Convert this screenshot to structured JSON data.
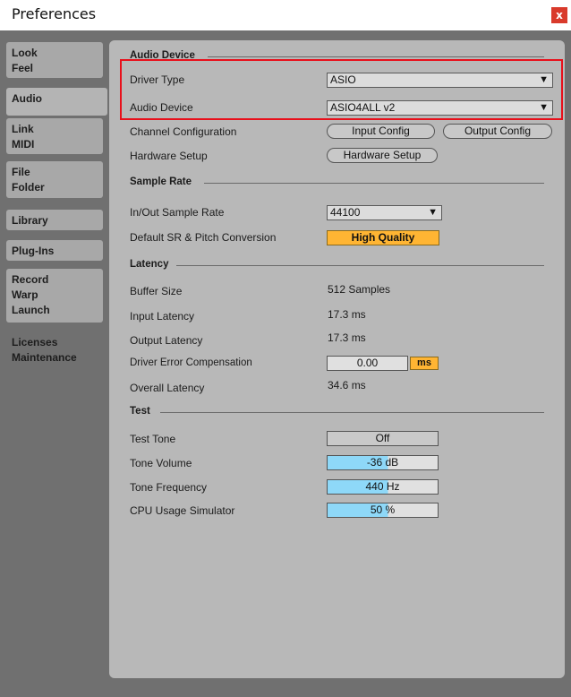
{
  "window": {
    "title": "Preferences",
    "close": "x"
  },
  "sidebar": {
    "tabs": [
      {
        "lines": [
          "Look",
          "Feel"
        ]
      },
      {
        "lines": [
          "Audio"
        ]
      },
      {
        "lines": [
          "Link",
          "MIDI"
        ]
      },
      {
        "lines": [
          "File",
          "Folder"
        ]
      },
      {
        "lines": [
          "Library"
        ]
      },
      {
        "lines": [
          "Plug-Ins"
        ]
      },
      {
        "lines": [
          "Record",
          "Warp",
          "Launch"
        ]
      },
      {
        "lines": [
          "Licenses",
          "Maintenance"
        ]
      }
    ]
  },
  "audio_device": {
    "section": "Audio Device",
    "driver_type_label": "Driver Type",
    "driver_type_value": "ASIO",
    "audio_device_label": "Audio Device",
    "audio_device_value": "ASIO4ALL v2",
    "channel_config_label": "Channel Configuration",
    "input_config": "Input Config",
    "output_config": "Output Config",
    "hardware_setup_label": "Hardware Setup",
    "hardware_setup_button": "Hardware Setup"
  },
  "sample_rate": {
    "section": "Sample Rate",
    "inout_label": "In/Out Sample Rate",
    "inout_value": "44100",
    "default_sr_label": "Default SR & Pitch Conversion",
    "default_sr_value": "High Quality"
  },
  "latency": {
    "section": "Latency",
    "buffer_label": "Buffer Size",
    "buffer_value": "512 Samples",
    "input_label": "Input Latency",
    "input_value": "17.3 ms",
    "output_label": "Output Latency",
    "output_value": "17.3 ms",
    "driver_comp_label": "Driver Error Compensation",
    "driver_comp_value": "0.00",
    "driver_comp_unit": "ms",
    "overall_label": "Overall Latency",
    "overall_value": "34.6 ms"
  },
  "test": {
    "section": "Test",
    "tone_label": "Test Tone",
    "tone_value": "Off",
    "volume_label": "Tone Volume",
    "volume_value": "-36 dB",
    "freq_label": "Tone Frequency",
    "freq_value": "440 Hz",
    "cpu_label": "CPU Usage Simulator",
    "cpu_value": "50 %"
  },
  "colors": {
    "highlight": "#e8101b",
    "accent_orange": "#ffb533",
    "accent_cyan": "#8ed8f8"
  }
}
